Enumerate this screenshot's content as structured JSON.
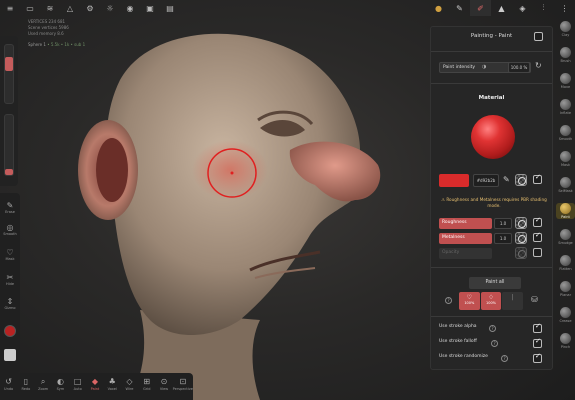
{
  "colors": {
    "accent": "#c05050",
    "paint": "#d92b2b",
    "panel": "#262626",
    "warning": "#e8c070"
  },
  "topbar": {
    "left_icons": [
      "menu-icon",
      "folder-icon",
      "layers-icon",
      "mountain-icon",
      "gear-icon",
      "sun-icon",
      "camera-icon",
      "video-icon",
      "gallery-icon"
    ],
    "right_icons": [
      "material-ball-icon",
      "brush-icon",
      "paint-icon",
      "triangle-icon",
      "cube-icon",
      "filter-icon",
      "more-icon"
    ]
  },
  "info": {
    "line1": "VERTICES   234 681",
    "line2": "Scene vertices  5986",
    "line3": "Used memory  8.6",
    "scene_name": "Sphere 1",
    "scene_stats": "• 5.5k • 1k • sub 1"
  },
  "left_tools": [
    {
      "icon": "↶",
      "label": "Undo"
    },
    {
      "icon": "✎",
      "label": "Erase"
    },
    {
      "icon": "◎",
      "label": "Smooth"
    },
    {
      "icon": "♡",
      "label": "Mask"
    },
    {
      "icon": "✂",
      "label": "Hide"
    },
    {
      "icon": "⇕",
      "label": "Gizmo"
    }
  ],
  "bottom_tools": [
    {
      "icon": "↺",
      "label": "Undo"
    },
    {
      "icon": "▯",
      "label": "Redo"
    },
    {
      "icon": "⌕",
      "label": "Zoom"
    },
    {
      "icon": "◐",
      "label": "Sym"
    },
    {
      "icon": "□",
      "label": "Auto"
    },
    {
      "icon": "◆",
      "label": "Paint"
    },
    {
      "icon": "♣",
      "label": "Voxel"
    },
    {
      "icon": "◇",
      "label": "Wire"
    },
    {
      "icon": "⊞",
      "label": "Grid"
    },
    {
      "icon": "⊙",
      "label": "View"
    },
    {
      "icon": "⊡",
      "label": "Perspective"
    }
  ],
  "right_tools": [
    "Clay",
    "Brush",
    "Move",
    "Inflate",
    "Smooth",
    "Mask",
    "SelMask",
    "Paint",
    "Smudge",
    "Flatten",
    "Planar",
    "Crease",
    "Pinch"
  ],
  "active_right_tool": "Paint",
  "panel": {
    "title": "Painting - Paint",
    "intensity_label": "Paint intensity",
    "intensity_value": "100.0 %",
    "material_title": "Material",
    "color_hex": "#d92b2b",
    "warning": "⚠ Roughness and Metalness requires PBR shading mode.",
    "properties": [
      {
        "label": "Roughness",
        "value": "1.0",
        "active": true
      },
      {
        "label": "Metalness",
        "value": "1.0",
        "active": true
      },
      {
        "label": "Opacity",
        "value": "",
        "active": false
      }
    ],
    "paint_all": "Paint all",
    "modes": [
      {
        "icon": "♡",
        "label": "100%"
      },
      {
        "icon": "♢",
        "label": "100%"
      },
      {
        "icon": "|",
        "label": ""
      }
    ],
    "options": [
      {
        "label": "Use stroke alpha",
        "checked": true
      },
      {
        "label": "Use stroke falloff",
        "checked": true
      },
      {
        "label": "Use stroke randomize",
        "checked": true
      }
    ]
  }
}
